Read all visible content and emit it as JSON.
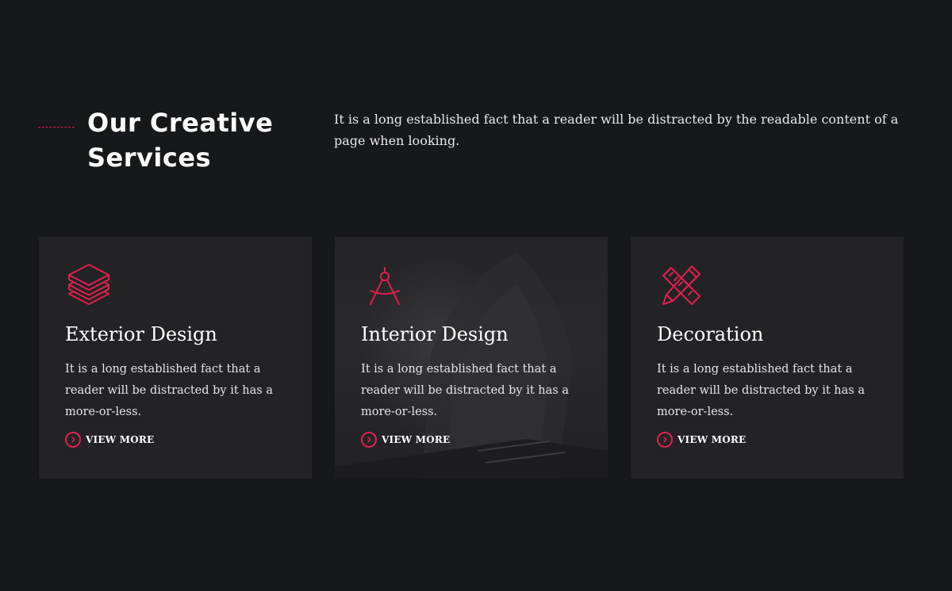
{
  "section": {
    "title_line1": "Our Creative",
    "title_line2": "Services",
    "intro": "It is a long established fact that a reader will be distracted by the readable content of a page when looking."
  },
  "colors": {
    "accent": "#e31e4f",
    "background": "#17181b",
    "card": "#232326"
  },
  "cards": [
    {
      "icon": "layers-icon",
      "title": "Exterior Design",
      "text": "It is a long established fact that a reader will be distracted by it has a more-or-less.",
      "link_label": "VIEW MORE"
    },
    {
      "icon": "compass-icon",
      "title": "Interior Design",
      "text": "It is a long established fact that a reader will be distracted by it has a more-or-less.",
      "link_label": "VIEW MORE"
    },
    {
      "icon": "pencil-ruler-icon",
      "title": "Decoration",
      "text": "It is a long established fact that a reader will be distracted by it has a more-or-less.",
      "link_label": "VIEW MORE"
    }
  ]
}
